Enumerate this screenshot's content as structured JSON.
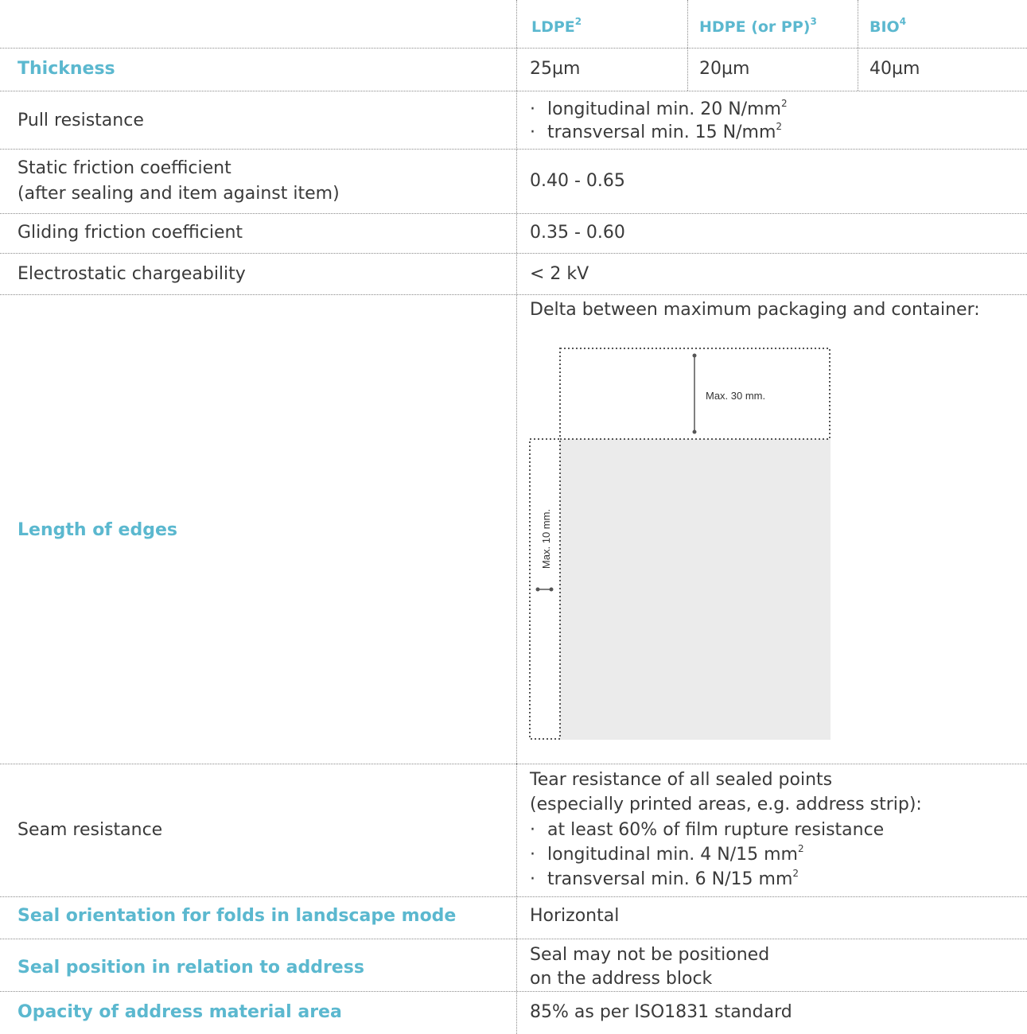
{
  "header": {
    "col1": {
      "label": "LDPE",
      "sup": "2"
    },
    "col2": {
      "label": "HDPE (or PP)",
      "sup": "3"
    },
    "col3": {
      "label": "BIO",
      "sup": "4"
    }
  },
  "rows": {
    "thickness": {
      "label": "Thickness",
      "ldpe": "25µm",
      "hdpe": "20µm",
      "bio": "40µm"
    },
    "pull": {
      "label": "Pull resistance",
      "line1": "longitudinal min. 20 N/mm",
      "line1_sup": "2",
      "line2": "transversal min. 15 N/mm",
      "line2_sup": "2"
    },
    "static": {
      "label_line1": "Static friction coefficient",
      "label_line2": "(after sealing and item against item)",
      "value": "0.40 - 0.65"
    },
    "gliding": {
      "label": "Gliding friction coefficient",
      "value": "0.35 - 0.60"
    },
    "electro": {
      "label": "Electrostatic chargeability",
      "value": "< 2 kV"
    },
    "edges": {
      "label": "Length of edges",
      "intro": "Delta between maximum packaging and container:",
      "top_label": "Max. 30 mm.",
      "side_label": "Max. 10 mm."
    },
    "seam": {
      "label": "Seam resistance",
      "line1": "Tear resistance of all sealed points",
      "line2": "(especially printed areas, e.g. address strip):",
      "bullet1": "at least 60% of film rupture resistance",
      "bullet2": "longitudinal min. 4 N/15 mm",
      "bullet2_sup": "2",
      "bullet3": "transversal min. 6 N/15 mm",
      "bullet3_sup": "2"
    },
    "seal_orientation": {
      "label": "Seal orientation for folds in landscape mode",
      "value": "Horizontal"
    },
    "seal_position": {
      "label": "Seal position in relation to address",
      "value_line1": "Seal may not be positioned",
      "value_line2": "on the address block"
    },
    "opacity": {
      "label": "Opacity of address material area",
      "value": "85% as per ISO1831 standard"
    }
  },
  "bullet_char": "·"
}
